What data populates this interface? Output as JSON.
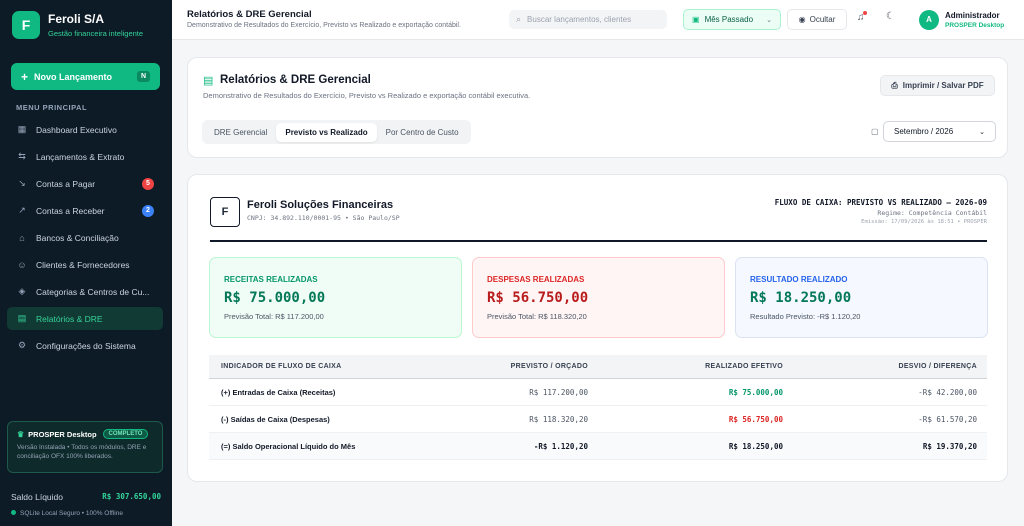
{
  "brand": {
    "logo": "F",
    "name": "Feroli S/A",
    "tagline": "Gestão financeira inteligente"
  },
  "sidebar": {
    "new_button": {
      "label": "Novo Lançamento",
      "shortcut": "N"
    },
    "menu_title": "MENU PRINCIPAL",
    "items": [
      {
        "label": "Dashboard Executivo",
        "icon": "dashboard-icon"
      },
      {
        "label": "Lançamentos & Extrato",
        "icon": "transfer-icon"
      },
      {
        "label": "Contas a Pagar",
        "icon": "trend-down-icon",
        "badge": "5",
        "badge_color": "#ef4444"
      },
      {
        "label": "Contas a Receber",
        "icon": "trend-up-icon",
        "badge": "2",
        "badge_color": "#3b82f6"
      },
      {
        "label": "Bancos & Conciliação",
        "icon": "bank-icon"
      },
      {
        "label": "Clientes & Fornecedores",
        "icon": "users-icon"
      },
      {
        "label": "Categorias & Centros de Cu...",
        "icon": "tags-icon"
      },
      {
        "label": "Relatórios & DRE",
        "icon": "report-icon",
        "active": true
      },
      {
        "label": "Configurações do Sistema",
        "icon": "gear-icon"
      }
    ],
    "plan": {
      "name": "PROSPER Desktop",
      "badge": "COMPLETO",
      "description": "Versão Instalada • Todos os módulos, DRE e conciliação OFX 100% liberados."
    },
    "balance": {
      "label": "Saldo Líquido",
      "value": "R$ 307.650,00"
    },
    "db_status": "SQLite Local Seguro • 100% Offline"
  },
  "header": {
    "title": "Relatórios & DRE Gerencial",
    "subtitle": "Demonstrativo de Resultados do Exercício, Previsto vs Realizado e exportação contábil.",
    "search_placeholder": "Buscar lançamentos, clientes",
    "period": "Mês Passado",
    "hide_label": "Ocultar",
    "user": {
      "initial": "A",
      "name": "Administrador",
      "role": "PROSPER Desktop"
    }
  },
  "report_panel": {
    "title": "Relatórios & DRE Gerencial",
    "subtitle": "Demonstrativo de Resultados do Exercício, Previsto vs Realizado e exportação contábil executiva.",
    "print_label": "Imprimir / Salvar PDF",
    "tabs": [
      "DRE Gerencial",
      "Previsto vs Realizado",
      "Por Centro de Custo"
    ],
    "active_tab": 1,
    "month": "Setembro / 2026"
  },
  "report": {
    "company_logo": "F",
    "company_name": "Feroli Soluções Financeiras",
    "company_info": "CNPJ: 34.892.110/0001-95 • São Paulo/SP",
    "title": "FLUXO DE CAIXA: PREVISTO VS REALIZADO — 2026-09",
    "regime": "Regime: Competência Contábil",
    "emission": "Emissão: 17/09/2026 às 18:51 • PROSPER",
    "kpis": [
      {
        "label": "RECEITAS REALIZADAS",
        "value": "R$ 75.000,00",
        "foot": "Previsão Total: R$ 117.200,00"
      },
      {
        "label": "DESPESAS REALIZADAS",
        "value": "R$ 56.750,00",
        "foot": "Previsão Total: R$ 118.320,20"
      },
      {
        "label": "RESULTADO REALIZADO",
        "value": "R$ 18.250,00",
        "foot": "Resultado Previsto: -R$ 1.120,20"
      }
    ],
    "table": {
      "headers": [
        "INDICADOR DE FLUXO DE CAIXA",
        "PREVISTO / ORÇADO",
        "REALIZADO EFETIVO",
        "DESVIO / DIFERENÇA"
      ],
      "rows": [
        {
          "indicator": "(+) Entradas de Caixa (Receitas)",
          "planned": "R$ 117.200,00",
          "actual": "R$ 75.000,00",
          "diff": "-R$ 42.200,00"
        },
        {
          "indicator": "(-) Saídas de Caixa (Despesas)",
          "planned": "R$ 118.320,20",
          "actual": "R$ 56.750,00",
          "diff": "-R$ 61.570,20"
        },
        {
          "indicator": "(=) Saldo Operacional Líquido do Mês",
          "planned": "-R$ 1.120,20",
          "actual": "R$ 18.250,00",
          "diff": "R$ 19.370,20"
        }
      ]
    }
  }
}
